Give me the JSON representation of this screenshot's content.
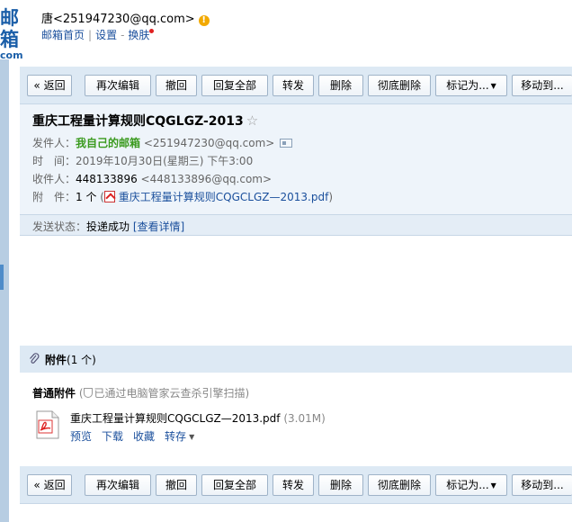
{
  "header": {
    "logo_main": "邮箱",
    "logo_sub": "com",
    "account": "唐<251947230@qq.com>",
    "links": [
      "邮箱首页",
      "设置",
      "换肤"
    ],
    "link_sep_a": "|",
    "link_sep_b": "-"
  },
  "toolbar": {
    "buttons": [
      "« 返回",
      "再次编辑",
      "撤回",
      "回复全部",
      "转发",
      "删除",
      "彻底删除",
      "标记为...",
      "移动到..."
    ]
  },
  "mail": {
    "subject": "重庆工程量计算规则CQGLGZ-2013",
    "from_label": "发件人：",
    "from_name": "我自己的邮箱",
    "from_addr": "<251947230@qq.com>",
    "time_label": "时　间：",
    "time_value": "2019年10月30日(星期三) 下午3:00",
    "to_label": "收件人：",
    "to_name": "448133896",
    "to_addr": "<448133896@qq.com>",
    "att_label": "附　件：",
    "att_count": "1 个",
    "att_open": "(",
    "att_file": "重庆工程量计算规则CQGCLGZ—2013.pdf",
    "att_close": ")",
    "status_label": "发送状态：",
    "status_value": "投递成功",
    "status_link": "[查看详情]"
  },
  "attachments": {
    "title": "附件",
    "count": "(1 个)",
    "kind": "普通附件",
    "scan_note": "已通过电脑管家云查杀引擎扫描",
    "scan_open": "(",
    "scan_close": ")",
    "file_name": "重庆工程量计算规则CQGCLGZ—2013.pdf",
    "file_size": "(3.01M)",
    "actions": [
      "预览",
      "下载",
      "收藏",
      "转存"
    ]
  },
  "colors": {
    "link": "#1a4f9c",
    "sender_green": "#3a9a1e",
    "toolbar_bg": "#dde9f4",
    "header_bg": "#eef4fa"
  }
}
